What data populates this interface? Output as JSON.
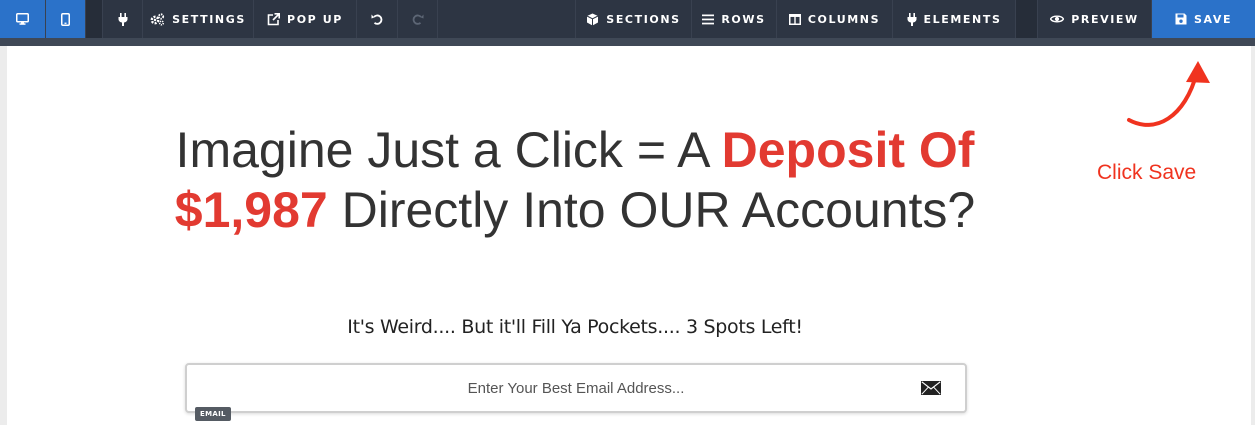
{
  "toolbar": {
    "settings_label": "SETTINGS",
    "popup_label": "POP UP",
    "sections_label": "SECTIONS",
    "rows_label": "ROWS",
    "columns_label": "COLUMNS",
    "elements_label": "ELEMENTS",
    "preview_label": "PREVIEW",
    "save_label": "SAVE",
    "icons": [
      "desktop-icon",
      "mobile-icon",
      "plug-icon",
      "cogs-icon",
      "external-link-icon",
      "undo-icon",
      "redo-icon",
      "cube-icon",
      "bars-icon",
      "columns-icon",
      "plug-icon",
      "eye-icon",
      "floppy-disk-icon"
    ]
  },
  "headline": {
    "part1": "Imagine Just a Click = A ",
    "part2_red": "Deposit Of $1,987",
    "part3": " Directly Into OUR Accounts?"
  },
  "subheadline": "It's Weird.... But it'll Fill Ya Pockets.... 3 Spots Left!",
  "email": {
    "placeholder": "Enter Your Best Email Address...",
    "value": "",
    "tag": "EMAIL",
    "icon": "envelope-icon"
  },
  "annotation": {
    "text": "Click Save",
    "color": "#f0331f"
  },
  "colors": {
    "toolbar_bg": "#2d3543",
    "accent_blue": "#2b72c9",
    "headline_red": "#e23a31",
    "text_dark": "#333333"
  }
}
